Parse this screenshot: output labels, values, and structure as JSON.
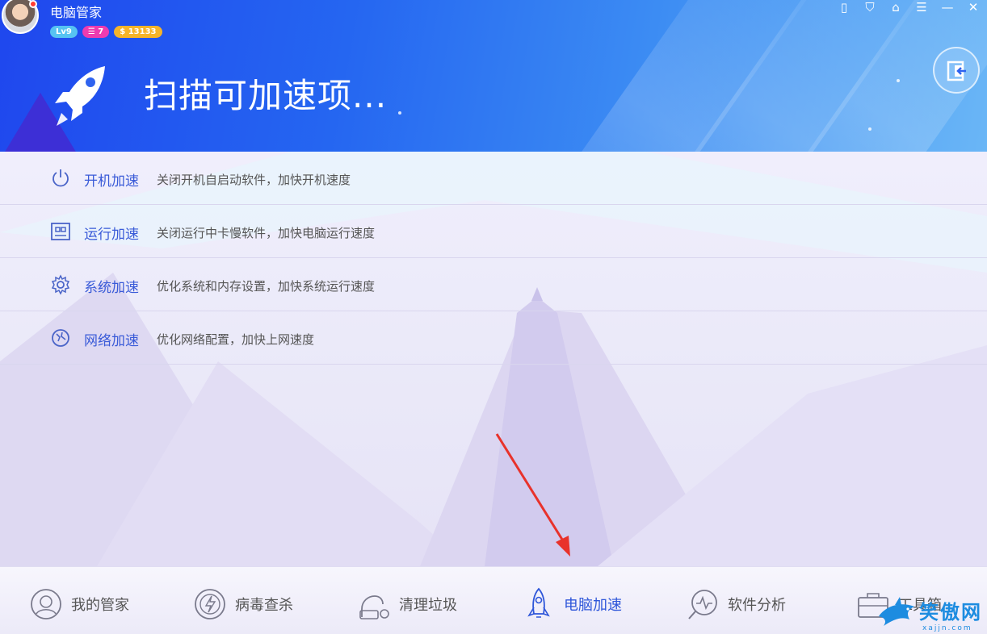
{
  "window": {
    "title": "电脑管家",
    "controls": [
      {
        "name": "phone-icon",
        "glyph": "▯"
      },
      {
        "name": "shield-icon",
        "glyph": "⛉"
      },
      {
        "name": "skin-icon",
        "glyph": "⌂"
      },
      {
        "name": "menu-icon",
        "glyph": "☰"
      },
      {
        "name": "minimize-icon",
        "glyph": "—"
      },
      {
        "name": "close-icon",
        "glyph": "✕"
      }
    ]
  },
  "user": {
    "level": "Lv9",
    "tasks": "☰ 7",
    "coins": "$ 13133"
  },
  "scan": {
    "title": "扫描可加速项..."
  },
  "items": [
    {
      "title": "开机加速",
      "desc": "关闭开机自启动软件，加快开机速度",
      "icon": "power-icon"
    },
    {
      "title": "运行加速",
      "desc": "关闭运行中卡慢软件，加快电脑运行速度",
      "icon": "memory-chip-icon"
    },
    {
      "title": "系统加速",
      "desc": "优化系统和内存设置，加快系统运行速度",
      "icon": "gear-icon"
    },
    {
      "title": "网络加速",
      "desc": "优化网络配置，加快上网速度",
      "icon": "network-icon"
    }
  ],
  "nav": [
    {
      "label": "我的管家",
      "icon": "butler-icon"
    },
    {
      "label": "病毒查杀",
      "icon": "virus-scan-icon"
    },
    {
      "label": "清理垃圾",
      "icon": "vacuum-icon"
    },
    {
      "label": "电脑加速",
      "icon": "rocket-icon",
      "active": true
    },
    {
      "label": "软件分析",
      "icon": "software-analysis-icon"
    },
    {
      "label": "工具箱",
      "icon": "toolbox-icon"
    }
  ],
  "watermark": {
    "text": "笑傲网",
    "sub": "xajjn.com"
  },
  "colors": {
    "accent": "#2e56d9",
    "header_start": "#1f47ee",
    "header_end": "#6ab6f6",
    "annotation_arrow": "#e8322b"
  }
}
